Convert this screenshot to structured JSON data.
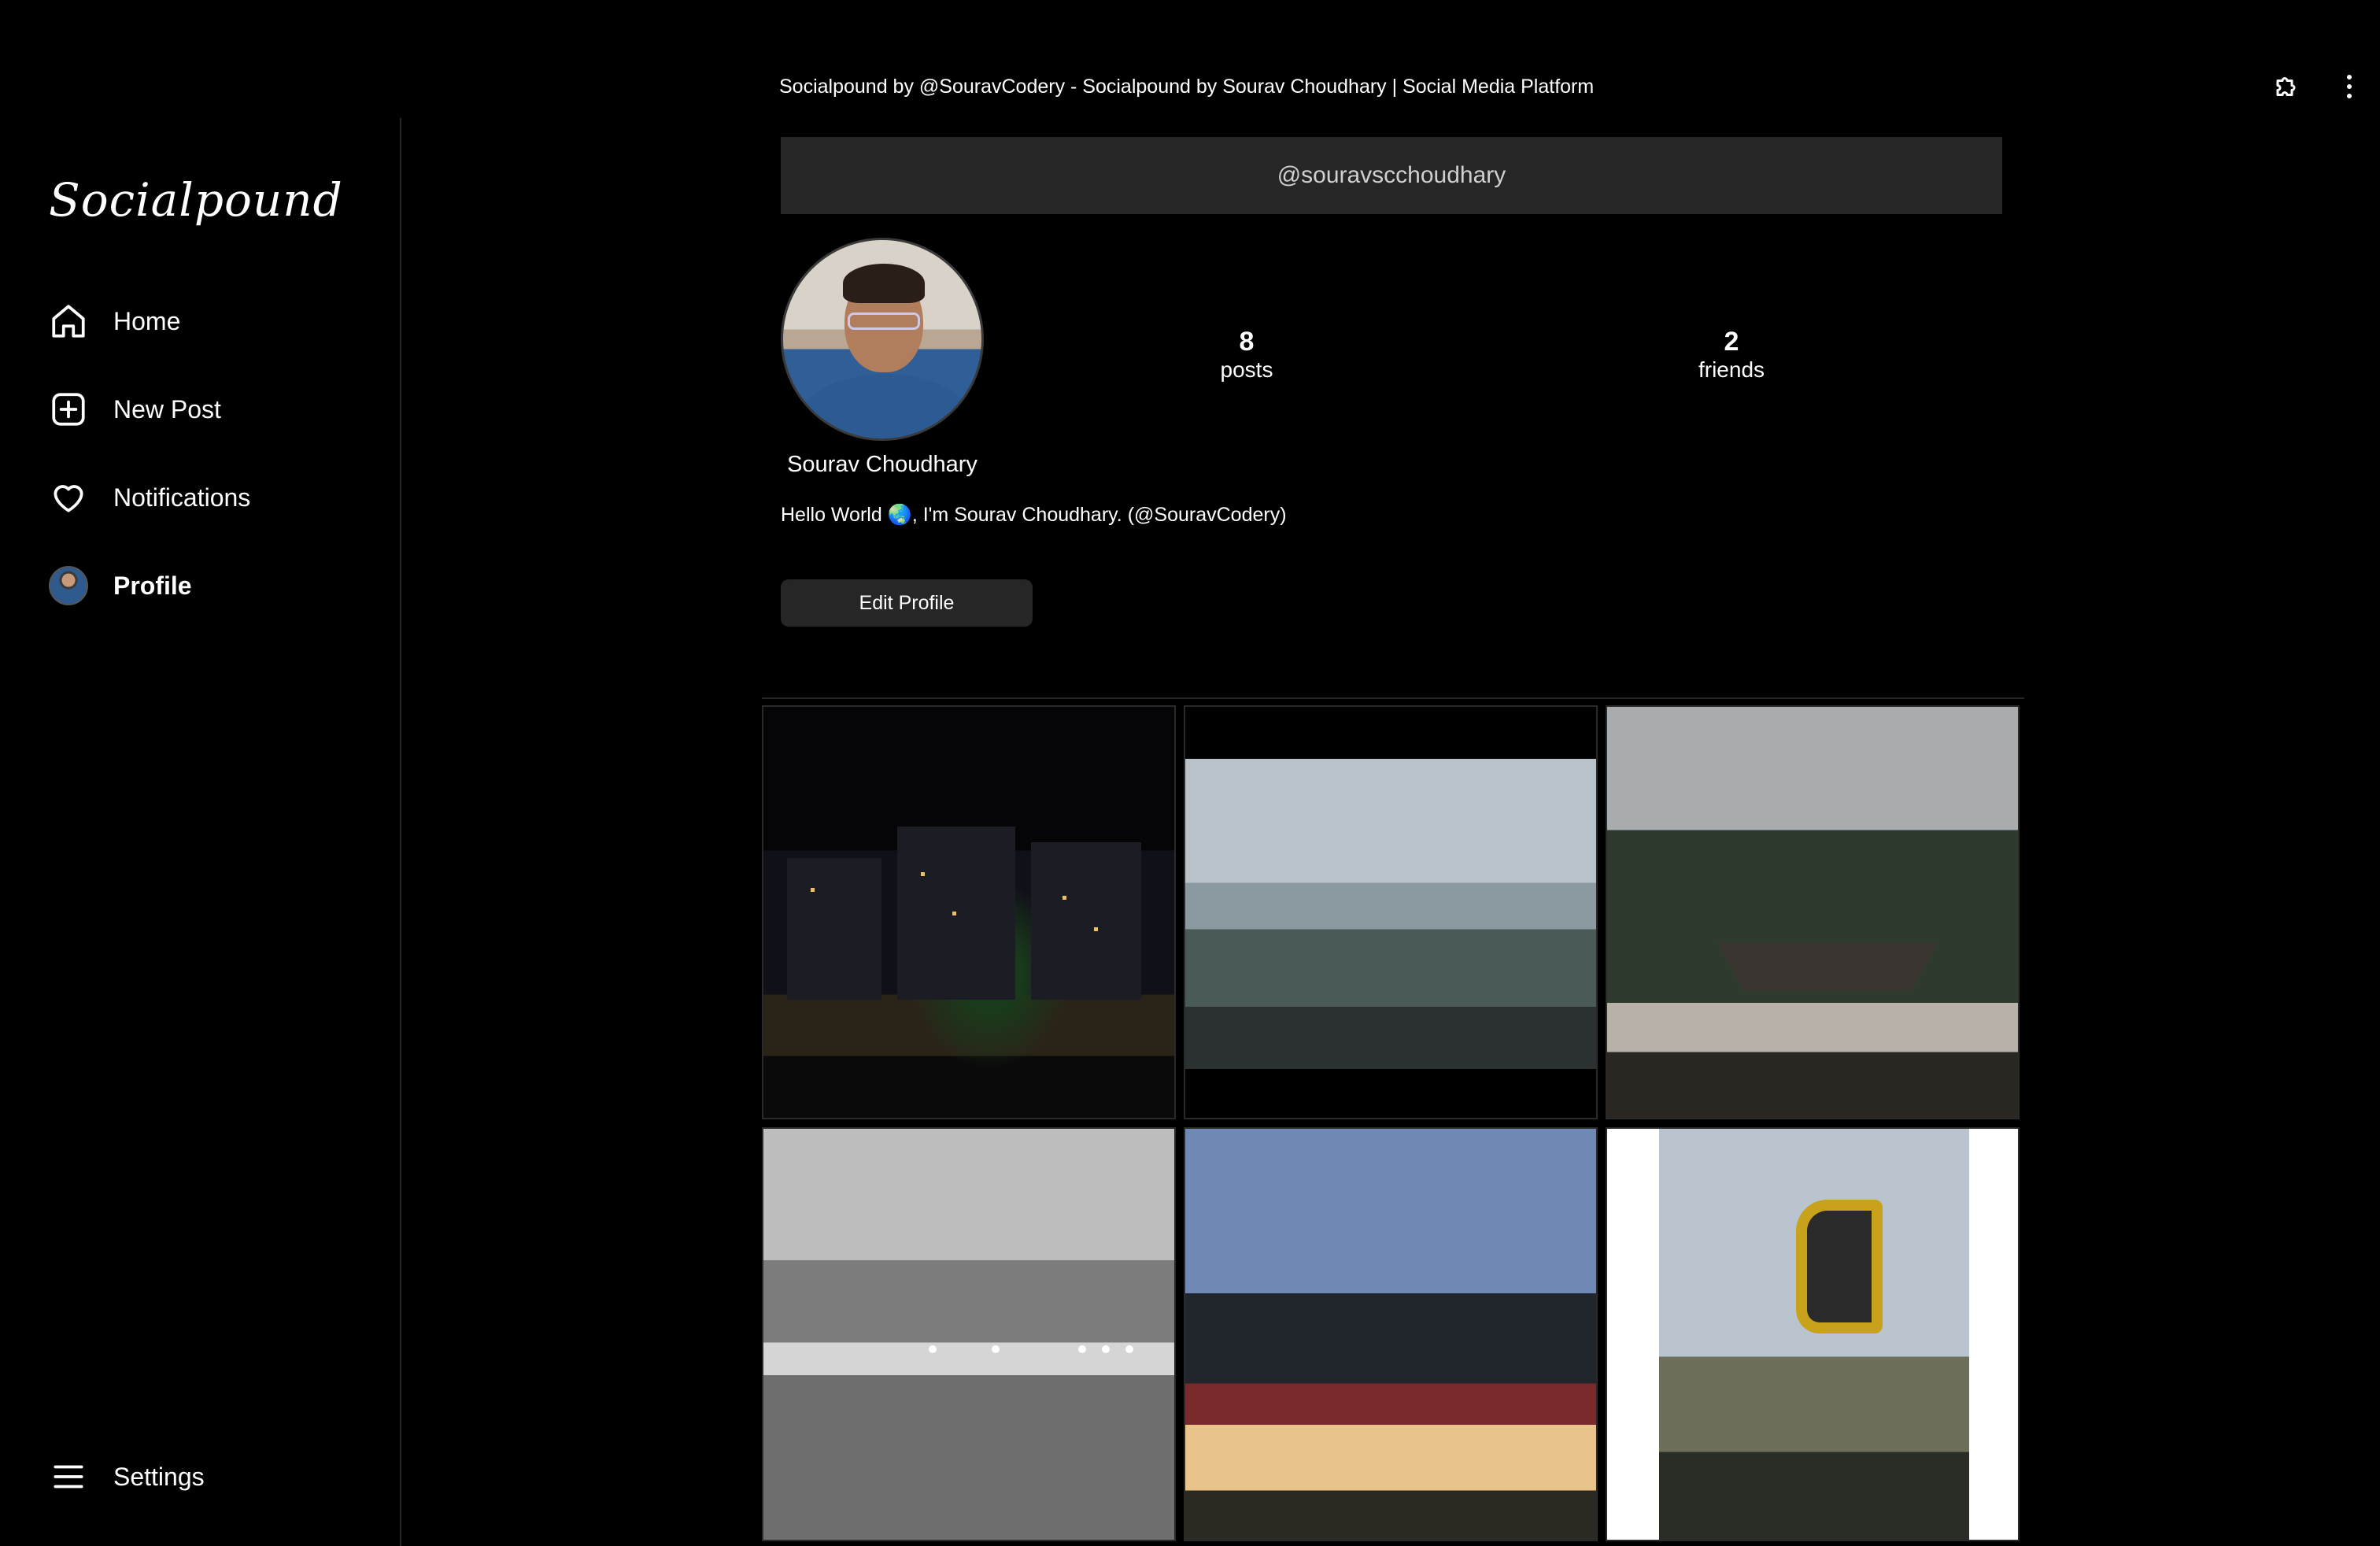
{
  "window": {
    "title": "Socialpound by @SouravCodery - Socialpound by Sourav Choudhary | Social Media Platform",
    "extension_icon": "puzzle-icon",
    "menu_icon": "kebab-menu-icon"
  },
  "sidebar": {
    "logo": "Socialpound",
    "nav": [
      {
        "label": "Home",
        "icon": "home-icon",
        "active": false
      },
      {
        "label": "New Post",
        "icon": "plus-square-icon",
        "active": false
      },
      {
        "label": "Notifications",
        "icon": "heart-icon",
        "active": false
      },
      {
        "label": "Profile",
        "icon": "avatar",
        "active": true
      }
    ],
    "settings": {
      "label": "Settings",
      "icon": "hamburger-icon"
    }
  },
  "profile": {
    "username": "@souravscchoudhary",
    "display_name": "Sourav Choudhary",
    "posts_count": "8",
    "posts_label": "posts",
    "friends_count": "2",
    "friends_label": "friends",
    "bio": "Hello World 🌏, I'm Sourav Choudhary. (@SouravCodery)",
    "edit_button": "Edit Profile"
  },
  "posts": [
    {
      "scene": "night-city-buildings"
    },
    {
      "scene": "cloudy-mountain-valley"
    },
    {
      "scene": "forest-temple"
    },
    {
      "scene": "monochrome-terrace-with-lights"
    },
    {
      "scene": "hotel-under-pine-trees"
    },
    {
      "scene": "bus-mirror-and-sky"
    }
  ],
  "colors": {
    "background": "#000000",
    "surface": "#262626",
    "text": "#ffffff",
    "muted_text": "#d0d0d0"
  }
}
